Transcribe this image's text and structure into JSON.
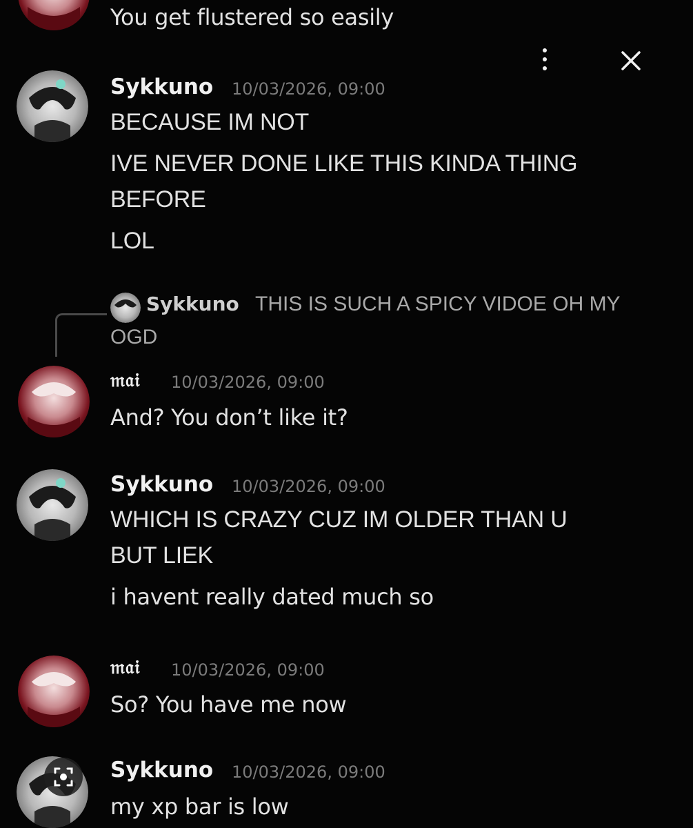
{
  "top_message": {
    "text": "You get flustered so easily"
  },
  "controls": {
    "menu_icon": "more-vertical-icon",
    "close_icon": "close-icon",
    "lens_icon": "visual-search-icon"
  },
  "messages": [
    {
      "author": "Sykkuno",
      "timestamp": "10/03/2026, 09:00",
      "lines": [
        "BECAUSE IM NOT",
        "IVE NEVER DONE LIKE THIS KINDA THING",
        "BEFORE",
        "LOL"
      ]
    },
    {
      "reply": {
        "author": "Sykkuno",
        "text_line1": "THIS IS SUCH A SPICY VIDOE OH MY",
        "text_line2": "OGD"
      },
      "author": "𝔪𝔞𝔦",
      "timestamp": "10/03/2026, 09:00",
      "lines": [
        "And? You don’t like it?"
      ]
    },
    {
      "author": "Sykkuno",
      "timestamp": "10/03/2026, 09:00",
      "lines": [
        "WHICH IS CRAZY CUZ IM OLDER THAN U",
        "BUT LIEK",
        "i havent really dated much so"
      ]
    },
    {
      "author": "𝔪𝔞𝔦",
      "timestamp": "10/03/2026, 09:00",
      "lines": [
        "So? You have me now"
      ]
    },
    {
      "author": "Sykkuno",
      "timestamp": "10/03/2026, 09:00",
      "lines": [
        "my xp bar is low"
      ]
    }
  ],
  "colors": {
    "background": "#050505",
    "text": "#e2e2e2",
    "timestamp": "#7b7b7b",
    "name": "#f0f0f0"
  }
}
